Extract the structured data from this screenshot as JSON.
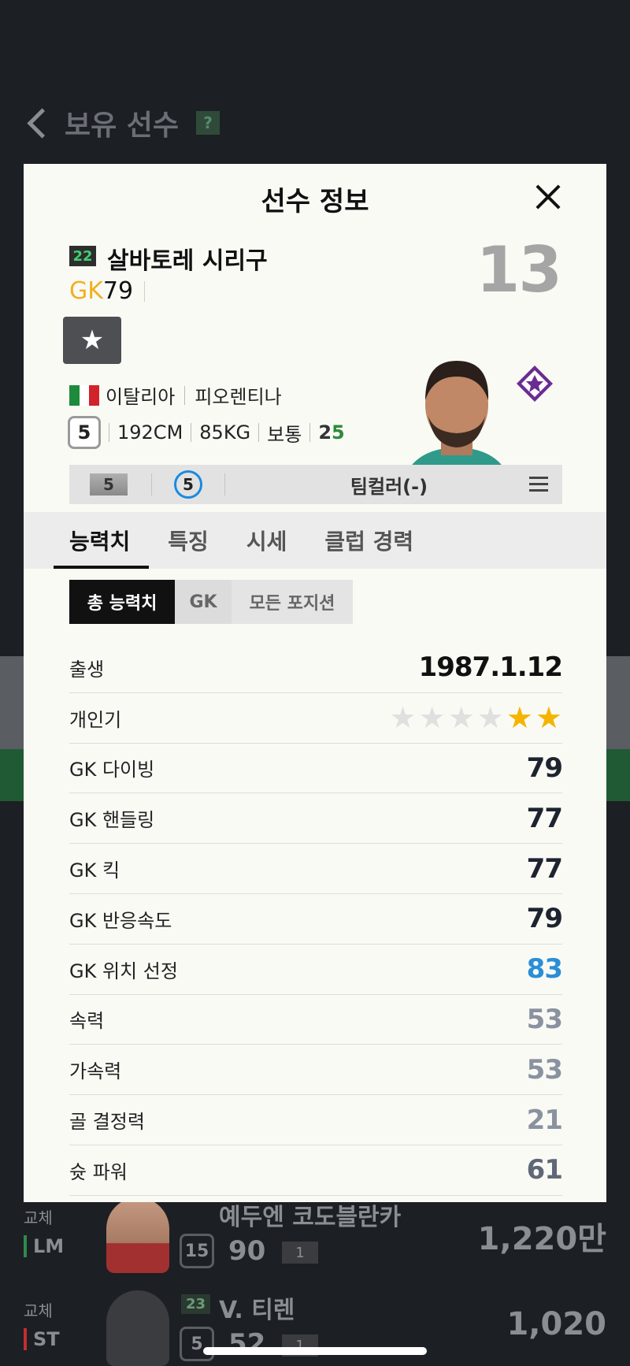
{
  "background": {
    "title": "보유 선수",
    "help": "?",
    "rows": [
      {
        "slot": "교체",
        "pos": "LM",
        "season": "",
        "name": "예두엔 코도블란카",
        "grade": "15",
        "ovr": "90",
        "level": "1",
        "price": "1,220만"
      },
      {
        "slot": "교체",
        "pos": "ST",
        "season": "23",
        "name": "V. 티렌",
        "grade": "5",
        "ovr": "52",
        "level": "1",
        "price": "1,020"
      }
    ]
  },
  "modal": {
    "title": "선수 정보",
    "player": {
      "season_badge": "22",
      "name": "살바토레 시리구",
      "position": "GK",
      "ovr": "79",
      "back_number": "13",
      "nation": "이탈리아",
      "club": "피오렌티나",
      "grade": "5",
      "height": "192CM",
      "weight": "85KG",
      "body_type": "보통",
      "skill_left": "2",
      "skill_right": "5"
    },
    "info_bar": {
      "enhance": "5",
      "level": "5",
      "team_color": "팀컬러(-)"
    },
    "tabs": [
      "능력치",
      "특징",
      "시세",
      "클럽 경력"
    ],
    "subtabs": [
      "총 능력치",
      "GK",
      "모든 포지션"
    ],
    "stats": [
      {
        "label": "출생",
        "value": "1987.1.12"
      },
      {
        "label": "개인기",
        "stars": 2,
        "max_stars": 6
      },
      {
        "label": "GK 다이빙",
        "value": "79"
      },
      {
        "label": "GK 핸들링",
        "value": "77"
      },
      {
        "label": "GK 킥",
        "value": "77"
      },
      {
        "label": "GK 반응속도",
        "value": "79"
      },
      {
        "label": "GK 위치 선정",
        "value": "83"
      },
      {
        "label": "속력",
        "value": "53"
      },
      {
        "label": "가속력",
        "value": "53"
      },
      {
        "label": "골 결정력",
        "value": "21"
      },
      {
        "label": "슛 파워",
        "value": "61"
      }
    ]
  },
  "colors": {
    "position": "#f0b020",
    "highlight_stat": "#2a8ed8",
    "star_on": "#f5b400",
    "season_text": "#40d070"
  }
}
